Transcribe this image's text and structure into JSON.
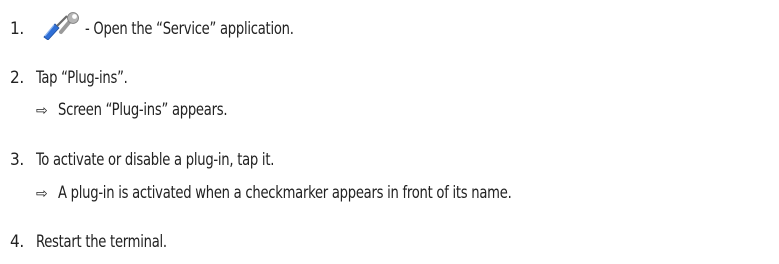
{
  "steps": [
    {
      "number": "1.",
      "text": "- Open the “Service” application.",
      "icon": "wrench-screwdriver-icon"
    },
    {
      "number": "2.",
      "text": "Tap “Plug-ins”.",
      "result": "Screen “Plug-ins” appears."
    },
    {
      "number": "3.",
      "text": "To activate or disable a plug-in, tap it.",
      "result": "A plug-in is activated when a checkmarker appears in front of its name."
    },
    {
      "number": "4.",
      "text": "Restart the terminal."
    }
  ],
  "result_arrow": "⇨",
  "colors": {
    "icon_blue": "#2f6fd6",
    "icon_gray": "#9a9a9a",
    "text": "#222222"
  }
}
